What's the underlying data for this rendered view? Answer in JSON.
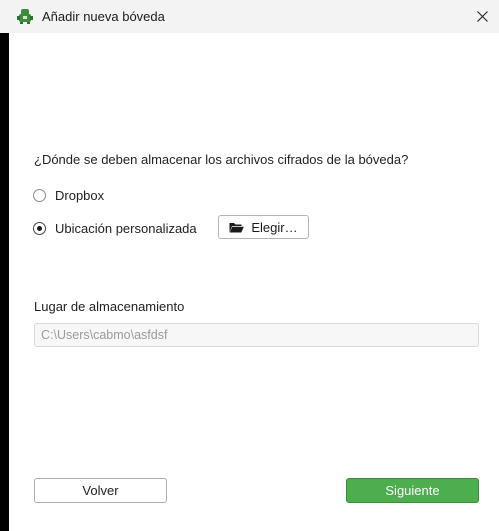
{
  "window": {
    "title": "Añadir nueva bóveda"
  },
  "question": "¿Dónde se deben almacenar los archivos cifrados de la bóveda?",
  "options": [
    {
      "label": "Dropbox",
      "selected": false
    },
    {
      "label": "Ubicación personalizada",
      "selected": true
    }
  ],
  "choose_button": {
    "label": "Elegir…"
  },
  "storage": {
    "label": "Lugar de almacenamiento",
    "path_value": "C:\\Users\\cabmo\\asfdsf"
  },
  "footer": {
    "back_label": "Volver",
    "next_label": "Siguiente"
  },
  "colors": {
    "accent_green": "#4cae4c",
    "app_icon_green": "#3d8b3d"
  },
  "icons": [
    "app-logo-icon",
    "close-icon",
    "folder-open-icon"
  ]
}
